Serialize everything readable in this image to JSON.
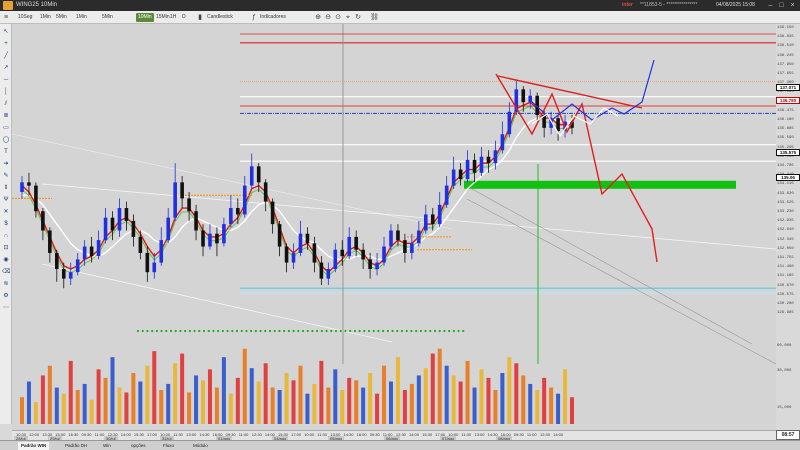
{
  "window": {
    "title": "WING25 10Min",
    "broker": "inter",
    "account": "**11853-5 - ****************",
    "clock": "04/08/2025 15:08"
  },
  "toolbar": {
    "timeframes": [
      "10Seg",
      "1Min",
      "5Min",
      "1Min",
      "5Min",
      "10Min",
      "15Min",
      "1H",
      "D"
    ],
    "active_timeframe_index": 5,
    "chart_type_label": "Candlestick",
    "indicators_label": "Indicadores"
  },
  "price_scale": {
    "ticks": [
      "139.150",
      "138.835",
      "138.540",
      "138.245",
      "137.950",
      "137.655",
      "137.360",
      "137.065",
      "136.770",
      "136.475",
      "136.180",
      "135.885",
      "135.590",
      "135.295",
      "135.000",
      "134.705",
      "134.410",
      "134.115",
      "133.820",
      "133.525",
      "133.230",
      "132.935",
      "132.640",
      "132.345",
      "132.050",
      "131.755",
      "131.460",
      "131.165",
      "130.870",
      "130.575",
      "130.280",
      "129.985"
    ],
    "badges": [
      {
        "label": "137.071",
        "color": "#111111"
      },
      {
        "label": "136.780",
        "color": "#c00000"
      },
      {
        "label": "135.575",
        "color": "#111111"
      },
      {
        "label": "135.06",
        "color": "#111111"
      }
    ],
    "volume_ticks": [
      "60,000",
      "30,000",
      "15,000"
    ]
  },
  "time_axis": {
    "ticks": [
      "10:30",
      "12:00",
      "13:30",
      "15:00",
      "16:30",
      "09:30",
      "11:00",
      "12:30",
      "14:00",
      "15:30",
      "17:00",
      "10:00",
      "11:30",
      "13:00",
      "14:30",
      "16:00",
      "09:30",
      "11:00",
      "12:30",
      "14:00",
      "15:30",
      "17:00",
      "10:00",
      "11:30",
      "13:00",
      "14:30",
      "16:00",
      "09:30",
      "11:00",
      "12:30",
      "14:00",
      "15:30",
      "17:00",
      "10:00",
      "11:30",
      "13:00",
      "14:30",
      "16:00",
      "09:30",
      "11:00",
      "12:30",
      "14:00"
    ],
    "days": [
      "28/jul",
      "29/jul",
      "30/jul",
      "31/jul",
      "01/ago",
      "04/ago",
      "05/ago",
      "06/ago",
      "07/ago",
      "08/ago"
    ],
    "current_time": "08:57"
  },
  "bottom_tabs": [
    "Padrão WIN",
    "Padrão DH",
    "Win",
    "opções",
    "Fluxo",
    "Módulo"
  ],
  "active_tab_index": 0,
  "chart_data": {
    "type": "candlestick",
    "instrument": "WING25",
    "interval": "10Min",
    "ylim": [
      129.985,
      139.15
    ],
    "horizontal_levels": [
      {
        "price": 138.75,
        "color": "#e11e1e",
        "style": "solid"
      },
      {
        "price": 137.55,
        "color": "#f0a080",
        "style": "dotted"
      },
      {
        "price": 137.071,
        "color": "#ffffff",
        "style": "solid"
      },
      {
        "price": 136.78,
        "color": "#e35a5a",
        "style": "solid"
      },
      {
        "price": 136.55,
        "color": "#2040c0",
        "style": "dash-dot"
      },
      {
        "price": 135.575,
        "color": "#ffffff",
        "style": "solid"
      },
      {
        "price": 135.06,
        "color": "#ffffff",
        "style": "solid"
      },
      {
        "price": 131.1,
        "color": "#5fd0e0",
        "style": "solid"
      },
      {
        "price": 130.95,
        "color": "#c0e0f0",
        "style": "solid"
      }
    ],
    "green_zone": {
      "from": 134.2,
      "to": 134.45
    },
    "candles": [
      [
        134.1,
        134.4,
        134.6,
        133.9
      ],
      [
        134.4,
        134.3,
        134.7,
        134.0
      ],
      [
        134.3,
        133.5,
        134.4,
        133.3
      ],
      [
        133.5,
        132.9,
        133.6,
        132.6
      ],
      [
        132.9,
        132.2,
        133.0,
        131.9
      ],
      [
        132.2,
        131.7,
        132.3,
        131.3
      ],
      [
        131.7,
        131.4,
        131.9,
        131.1
      ],
      [
        131.4,
        131.6,
        131.9,
        131.2
      ],
      [
        131.6,
        132.0,
        132.2,
        131.5
      ],
      [
        132.0,
        132.4,
        132.6,
        131.8
      ],
      [
        132.4,
        132.1,
        132.7,
        131.9
      ],
      [
        132.1,
        132.6,
        132.9,
        132.0
      ],
      [
        132.6,
        133.3,
        133.6,
        132.5
      ],
      [
        133.3,
        132.9,
        133.5,
        132.6
      ],
      [
        132.9,
        133.6,
        133.9,
        132.7
      ],
      [
        133.6,
        133.2,
        133.8,
        132.9
      ],
      [
        133.2,
        132.7,
        133.4,
        132.4
      ],
      [
        132.7,
        132.2,
        132.9,
        132.0
      ],
      [
        132.2,
        131.6,
        132.4,
        131.3
      ],
      [
        131.6,
        131.9,
        132.2,
        131.4
      ],
      [
        131.9,
        132.6,
        133.0,
        131.8
      ],
      [
        132.6,
        133.3,
        133.6,
        132.5
      ],
      [
        133.3,
        134.4,
        135.0,
        133.2
      ],
      [
        134.4,
        133.9,
        134.6,
        133.6
      ],
      [
        133.9,
        133.5,
        134.1,
        133.2
      ],
      [
        133.5,
        132.9,
        133.7,
        132.6
      ],
      [
        132.9,
        132.4,
        133.1,
        132.1
      ],
      [
        132.4,
        132.8,
        133.1,
        132.3
      ],
      [
        132.8,
        132.5,
        133.0,
        132.1
      ],
      [
        132.5,
        133.1,
        133.3,
        132.4
      ],
      [
        133.1,
        133.6,
        134.0,
        133.0
      ],
      [
        133.6,
        133.4,
        133.9,
        133.1
      ],
      [
        133.4,
        134.3,
        134.6,
        133.3
      ],
      [
        134.3,
        134.9,
        135.3,
        134.2
      ],
      [
        134.9,
        134.4,
        135.0,
        134.1
      ],
      [
        134.4,
        133.8,
        134.5,
        133.5
      ],
      [
        133.8,
        133.1,
        133.9,
        132.8
      ],
      [
        133.1,
        132.4,
        133.2,
        132.1
      ],
      [
        132.4,
        131.9,
        132.5,
        131.6
      ],
      [
        131.9,
        132.2,
        132.5,
        131.7
      ],
      [
        132.2,
        132.8,
        133.2,
        132.1
      ],
      [
        132.8,
        132.5,
        133.0,
        132.3
      ],
      [
        132.5,
        131.9,
        132.7,
        131.6
      ],
      [
        131.9,
        131.4,
        132.1,
        131.2
      ],
      [
        131.4,
        131.7,
        131.9,
        131.2
      ],
      [
        131.7,
        132.3,
        132.5,
        131.6
      ],
      [
        132.3,
        132.1,
        132.6,
        131.8
      ],
      [
        132.1,
        132.7,
        133.0,
        132.0
      ],
      [
        132.7,
        132.3,
        132.9,
        132.1
      ],
      [
        132.3,
        132.0,
        132.5,
        131.7
      ],
      [
        132.0,
        131.7,
        132.2,
        131.4
      ],
      [
        131.7,
        131.9,
        132.2,
        131.5
      ],
      [
        131.9,
        132.4,
        132.7,
        131.8
      ],
      [
        132.4,
        132.9,
        133.1,
        132.3
      ],
      [
        132.9,
        132.6,
        133.1,
        132.4
      ],
      [
        132.6,
        132.2,
        132.8,
        131.9
      ],
      [
        132.2,
        132.5,
        132.8,
        132.0
      ],
      [
        132.5,
        132.9,
        133.2,
        132.4
      ],
      [
        132.9,
        133.4,
        133.7,
        132.8
      ],
      [
        133.4,
        133.1,
        133.6,
        132.9
      ],
      [
        133.1,
        133.7,
        134.1,
        133.0
      ],
      [
        133.7,
        134.3,
        134.6,
        133.6
      ],
      [
        134.3,
        134.8,
        135.2,
        134.2
      ],
      [
        134.8,
        134.5,
        135.0,
        134.3
      ],
      [
        134.5,
        135.1,
        135.4,
        134.4
      ],
      [
        135.1,
        134.7,
        135.3,
        134.4
      ],
      [
        134.7,
        135.2,
        135.5,
        134.6
      ],
      [
        135.2,
        135.0,
        135.4,
        134.7
      ],
      [
        135.0,
        135.4,
        135.7,
        134.8
      ],
      [
        135.4,
        135.9,
        136.3,
        135.3
      ],
      [
        135.9,
        136.6,
        136.9,
        135.8
      ],
      [
        136.6,
        137.3,
        137.6,
        136.5
      ],
      [
        137.3,
        136.9,
        137.4,
        136.6
      ],
      [
        136.9,
        137.1,
        137.3,
        136.7
      ],
      [
        137.1,
        136.5,
        137.2,
        136.3
      ],
      [
        136.5,
        136.1,
        136.7,
        135.8
      ],
      [
        136.1,
        136.4,
        136.6,
        135.9
      ],
      [
        136.4,
        136.0,
        136.5,
        135.7
      ],
      [
        136.0,
        136.3,
        136.5,
        135.8
      ],
      [
        136.3,
        136.1,
        136.5,
        135.9
      ]
    ],
    "ma_fast": [
      134.3,
      134.1,
      133.7,
      133.2,
      132.7,
      132.2,
      131.8,
      131.7,
      131.8,
      132.0,
      132.1,
      132.3,
      132.7,
      132.9,
      133.2,
      133.3,
      133.1,
      132.8,
      132.4,
      132.1,
      132.3,
      132.7,
      133.3,
      133.6,
      133.6,
      133.3,
      132.9,
      132.7,
      132.7,
      132.8,
      133.1,
      133.3,
      133.7,
      134.2,
      134.3,
      134.1,
      133.6,
      133.0,
      132.4,
      132.2,
      132.4,
      132.5,
      132.2,
      131.8,
      131.6,
      131.8,
      132.0,
      132.3,
      132.4,
      132.2,
      131.9,
      131.8,
      132.0,
      132.4,
      132.6,
      132.5,
      132.5,
      132.7,
      133.1,
      133.1,
      133.4,
      133.9,
      134.4,
      134.6,
      134.8,
      134.8,
      135.0,
      135.0,
      135.2,
      135.6,
      136.1,
      136.7,
      136.8,
      136.9,
      136.7,
      136.4,
      136.4,
      136.2,
      136.2,
      136.2
    ],
    "ma_slow": [
      134.0,
      134.0,
      133.9,
      133.7,
      133.4,
      133.1,
      132.8,
      132.5,
      132.3,
      132.2,
      132.1,
      132.1,
      132.2,
      132.4,
      132.6,
      132.8,
      132.9,
      132.9,
      132.8,
      132.6,
      132.5,
      132.5,
      132.7,
      133.0,
      133.2,
      133.3,
      133.2,
      133.1,
      133.0,
      132.9,
      132.9,
      133.0,
      133.2,
      133.5,
      133.7,
      133.8,
      133.7,
      133.5,
      133.2,
      132.9,
      132.7,
      132.6,
      132.5,
      132.3,
      132.1,
      132.0,
      132.0,
      132.0,
      132.1,
      132.1,
      132.1,
      132.0,
      132.0,
      132.1,
      132.2,
      132.3,
      132.4,
      132.5,
      132.7,
      132.8,
      133.0,
      133.3,
      133.6,
      133.9,
      134.2,
      134.4,
      134.6,
      134.8,
      134.9,
      135.1,
      135.4,
      135.8,
      136.1,
      136.3,
      136.4,
      136.4,
      136.4,
      136.3,
      136.3,
      136.3
    ],
    "volumes": [
      22,
      35,
      18,
      40,
      48,
      30,
      25,
      52,
      28,
      33,
      20,
      45,
      38,
      55,
      30,
      26,
      42,
      35,
      48,
      60,
      28,
      33,
      50,
      58,
      26,
      40,
      36,
      45,
      30,
      55,
      25,
      38,
      62,
      46,
      35,
      50,
      30,
      28,
      42,
      36,
      48,
      25,
      33,
      52,
      30,
      45,
      28,
      38,
      36,
      30,
      42,
      25,
      48,
      35,
      55,
      28,
      33,
      40,
      46,
      58,
      62,
      48,
      40,
      35,
      52,
      30,
      45,
      38,
      28,
      42,
      55,
      50,
      40,
      33,
      28,
      38,
      30,
      25,
      45,
      22
    ],
    "volume_colors": [
      "#e87f2a",
      "#3a5fcd",
      "#e8b83a",
      "#e04040"
    ]
  }
}
